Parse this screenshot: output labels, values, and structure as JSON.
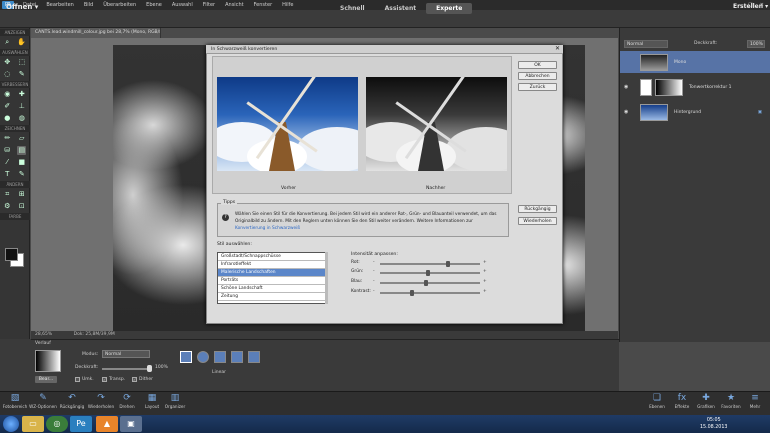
{
  "menubar": {
    "logo": "",
    "items": [
      "Datei",
      "Bearbeiten",
      "Bild",
      "Überarbeiten",
      "Ebene",
      "Auswahl",
      "Filter",
      "Ansicht",
      "Fenster",
      "Hilfe"
    ],
    "min": "–",
    "max": "□",
    "close": "✕"
  },
  "modebar": {
    "open": "Öffnen ▾",
    "modes": [
      "Schnell",
      "Assistent",
      "Experte"
    ],
    "active_mode": "Experte",
    "create": "Erstellen ▾"
  },
  "toolbox": {
    "sections": [
      "ANZEIGEN",
      "AUSWÄHLEN",
      "VERBESSERN",
      "ZEICHNEN",
      "ÄNDERN",
      "FARBE"
    ]
  },
  "document": {
    "tab": "CANTS.lead.windmill_colour.jpg bei 28,7% (Mono, RGB/8) *",
    "zoom": "28,65%",
    "doc_size": "Dok: 25,8M/39,9M"
  },
  "layers": {
    "blend": "Normal",
    "opacity_label": "Deckkraft:",
    "opacity_value": "100%",
    "items": [
      {
        "name": "Mono"
      },
      {
        "name": "Tonwertkorrektur 1"
      },
      {
        "name": "Hintergrund"
      }
    ]
  },
  "tool_options": {
    "label": "Verlauf",
    "edit": "Bear...",
    "mode_label": "Modus:",
    "mode_value": "Normal",
    "opacity_label": "Deckkraft:",
    "opacity_value": "100%",
    "checks": [
      {
        "label": "Umk.",
        "checked": false
      },
      {
        "label": "Transp.",
        "checked": true
      },
      {
        "label": "Dither",
        "checked": true
      }
    ],
    "type_label": "Linear"
  },
  "bottom_bar": {
    "left": [
      "Fotobereich",
      "WZ-Optionen",
      "Rückgängig",
      "Wiederholen",
      "Drehen",
      "Layout",
      "Organizer"
    ],
    "right": [
      "Ebenen",
      "Effekte",
      "Grafiken",
      "Favoriten",
      "Mehr"
    ]
  },
  "taskbar": {
    "time": "05:05",
    "date": "15.08.2013"
  },
  "dialog": {
    "title": "In Schwarzweiß konvertieren",
    "before": "Vorher",
    "after": "Nachher",
    "tips_title": "Tipps",
    "tips_text": "Wählen Sie einen Stil für die Konvertierung. Bei jedem Stil wird ein anderer Rot-, Grün- und Blauanteil verwendet, um das Originalbild zu ändern. Mit den Reglern unten können Sie den Stil weiter verändern. Weitere Informationen zur ",
    "tips_link": "Konvertierung in Schwarzweiß",
    "style_label": "Stil auswählen:",
    "styles": [
      "Großstadt/Schnappschüsse",
      "Infrarotleffekt",
      "Malerische Landschaften",
      "Porträts",
      "Schöne Landschaft",
      "Zeitung"
    ],
    "selected_style": 2,
    "adjust_label": "Intensität anpassen:",
    "sliders": [
      {
        "label": "Rot:",
        "value": 0.68
      },
      {
        "label": "Grün:",
        "value": 0.48
      },
      {
        "label": "Blau:",
        "value": 0.46
      },
      {
        "label": "Kontrast:",
        "value": 0.32
      }
    ],
    "minus": "-",
    "plus": "+",
    "buttons": {
      "ok": "OK",
      "cancel": "Abbrechen",
      "back": "Zurück",
      "undo": "Rückgängig",
      "redo": "Wiederholen"
    }
  }
}
